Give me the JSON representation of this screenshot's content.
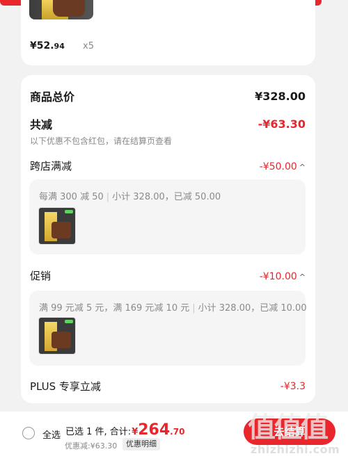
{
  "top_item": {
    "price_main": "¥52.",
    "price_cents": "94",
    "quantity": "x5"
  },
  "summary": {
    "goods_total_label": "商品总价",
    "goods_total_value": "¥328.00",
    "total_discount_label": "共减",
    "total_discount_value": "-¥63.30",
    "note": "以下优惠不包含红包，请在结算页查看"
  },
  "cross_store": {
    "label": "跨店满减",
    "value": "-¥50.00",
    "detail_rule": "每满 300 减 50",
    "detail_subtotal": "小计 328.00，已减 50.00"
  },
  "promotion": {
    "label": "促销",
    "value": "-¥10.00",
    "detail_rule": "满 99 元减 5 元，满 169 元减 10 元",
    "detail_subtotal": "小计 328.00，已减 10.00"
  },
  "plus": {
    "label": "PLUS 专享立减",
    "value": "-¥3.3"
  },
  "bottom": {
    "select_all": "全选",
    "selected_text": "已选 1 件, 合计:",
    "total_currency": "¥",
    "total_int": "264",
    "total_dec": ".70",
    "discount_text": "优惠减:¥63.30",
    "detail_button": "优惠明细",
    "checkout_button": "去结算"
  },
  "watermark": {
    "logo": "值值值",
    "url": "zhizhizhi.com"
  },
  "colors": {
    "accent": "#e8262b",
    "muted": "#888888"
  }
}
